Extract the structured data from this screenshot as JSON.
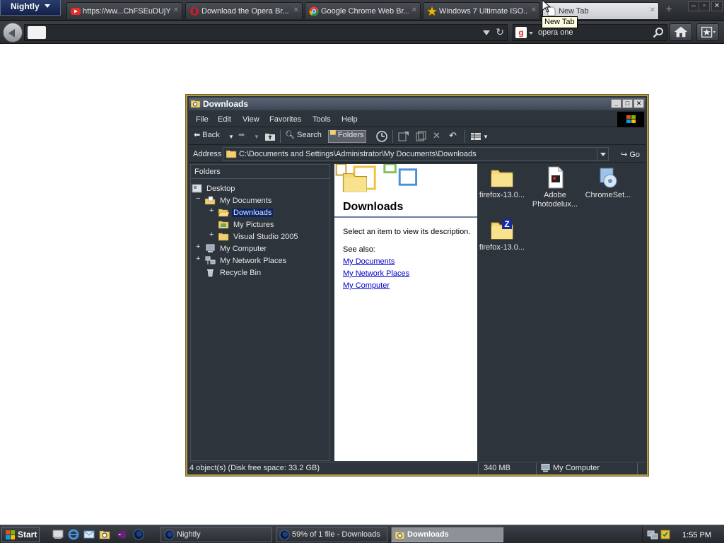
{
  "browser": {
    "app_button_label": "Nightly",
    "tabs": [
      {
        "label": "https://ww...ChFSEuDUjY",
        "icon": "youtube-icon"
      },
      {
        "label": "Download the Opera Br...",
        "icon": "opera-icon"
      },
      {
        "label": "Google Chrome Web Br...",
        "icon": "chrome-icon"
      },
      {
        "label": "Windows 7 Ultimate ISO...",
        "icon": "star-icon"
      },
      {
        "label": "New Tab",
        "icon": "page-icon"
      }
    ],
    "tooltip": "New Tab",
    "search_text": "opera one"
  },
  "explorer": {
    "title": "Downloads",
    "menus": [
      "File",
      "Edit",
      "View",
      "Favorites",
      "Tools",
      "Help"
    ],
    "toolbar": {
      "back": "Back",
      "search": "Search",
      "folders": "Folders"
    },
    "address_label": "Address",
    "address_value": "C:\\Documents and Settings\\Administrator\\My Documents\\Downloads",
    "go_label": "Go",
    "folders_header": "Folders",
    "tree": {
      "desktop": "Desktop",
      "my_documents": "My Documents",
      "downloads": "Downloads",
      "my_pictures": "My Pictures",
      "visual_studio": "Visual Studio 2005",
      "my_computer": "My Computer",
      "my_network_places": "My Network Places",
      "recycle_bin": "Recycle Bin"
    },
    "info": {
      "title": "Downloads",
      "description": "Select an item to view its description.",
      "see_also": "See also:",
      "links": [
        "My Documents",
        "My Network Places",
        "My Computer"
      ]
    },
    "files": [
      {
        "line1": "firefox-13.0...",
        "line2": "",
        "icon": "folder-icon"
      },
      {
        "line1": "Adobe",
        "line2": "Photodelux...",
        "icon": "document-icon"
      },
      {
        "line1": "ChromeSet...",
        "line2": "",
        "icon": "installer-icon"
      },
      {
        "line1": "firefox-13.0...",
        "line2": "",
        "icon": "zip-folder-icon"
      }
    ],
    "status": {
      "objects": "4 object(s) (Disk free space: 33.2 GB)",
      "size": "340 MB",
      "location": "My Computer"
    }
  },
  "taskbar": {
    "start_label": "Start",
    "buttons": [
      {
        "label": "Nightly",
        "icon": "nightly-icon"
      },
      {
        "label": "59% of 1 file - Downloads",
        "icon": "nightly-icon"
      },
      {
        "label": "Downloads",
        "icon": "explorer-icon"
      }
    ],
    "clock": "1:55 PM"
  }
}
